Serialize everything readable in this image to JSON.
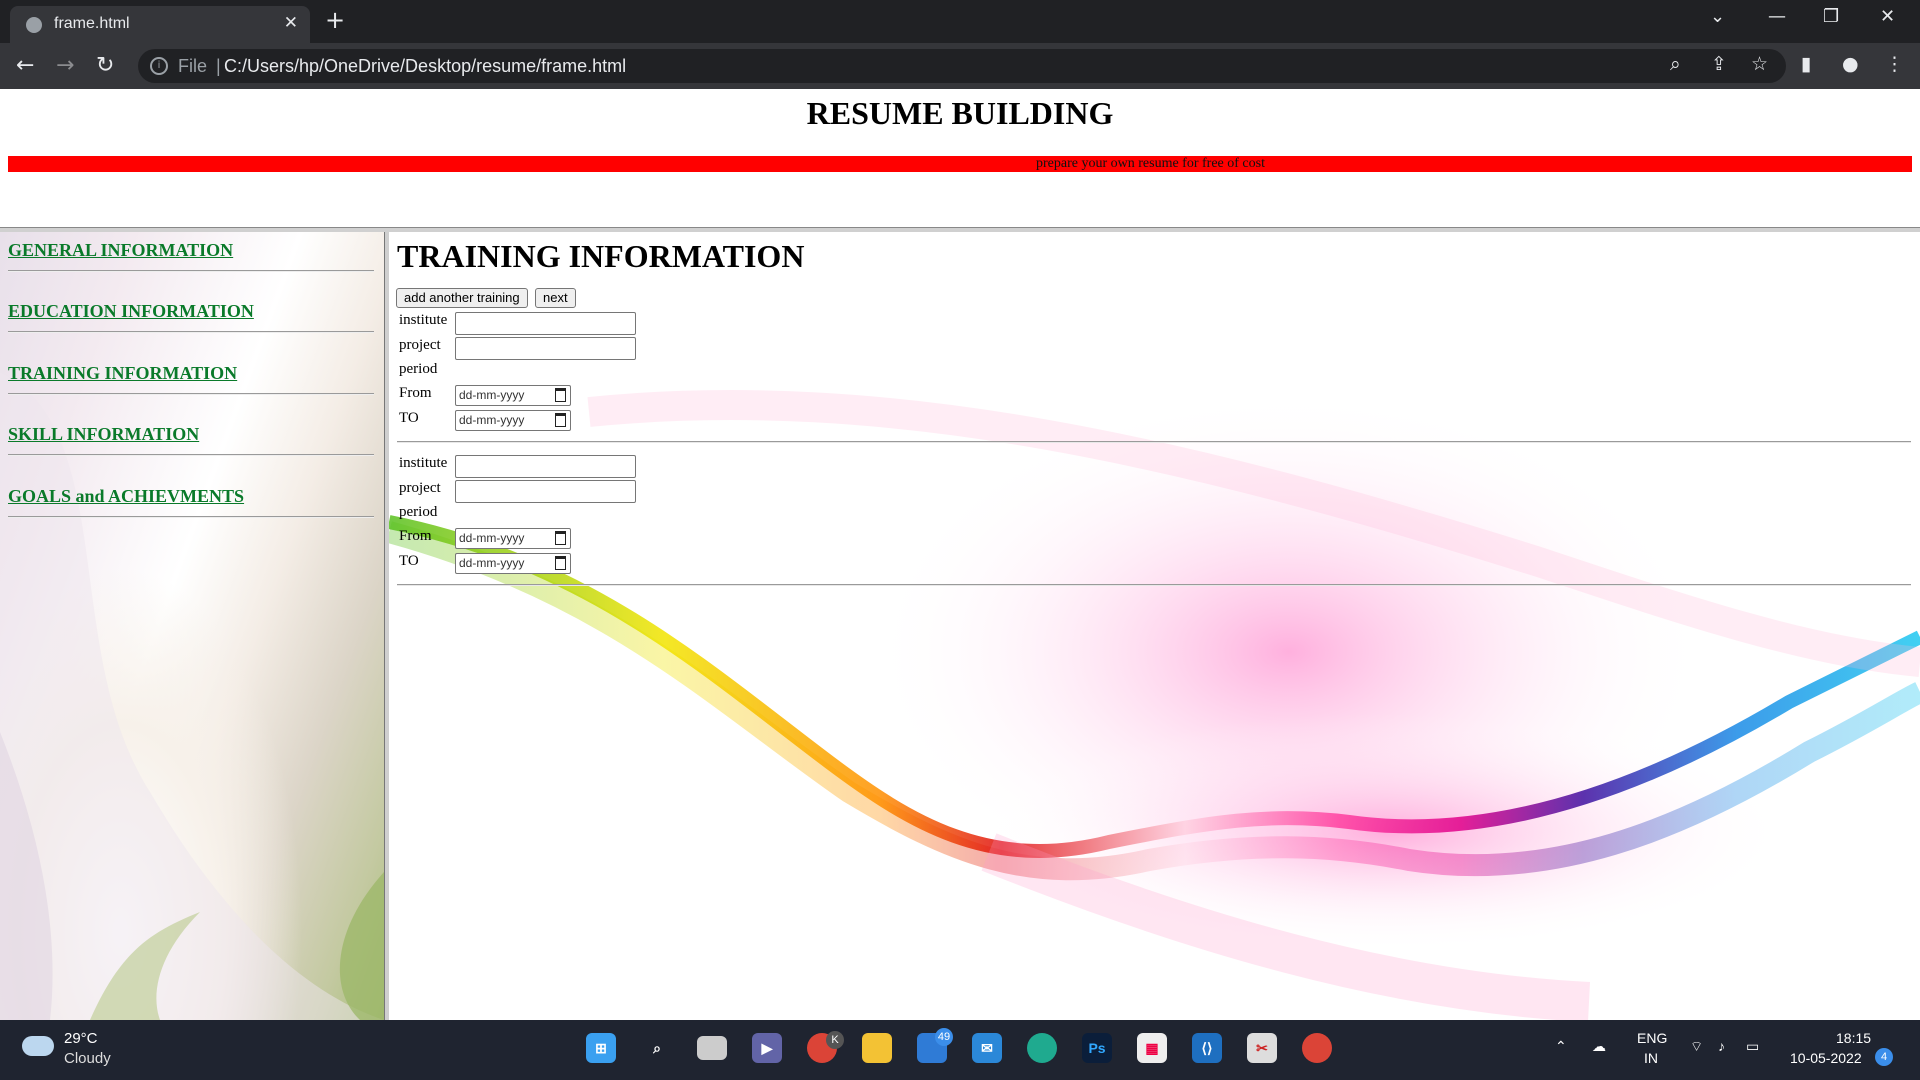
{
  "browser": {
    "tab_title": "frame.html",
    "new_tab": "+",
    "close_tab": "✕",
    "file_label": "File",
    "address": "C:/Users/hp/OneDrive/Desktop/resume/frame.html"
  },
  "header": {
    "title": "RESUME BUILDING",
    "marquee_text": "prepare your own resume for free of cost",
    "marquee_color": "#ff0000"
  },
  "sidebar": {
    "link_color": "#0a7a2a",
    "items": [
      {
        "label": "GENERAL INFORMATION"
      },
      {
        "label": "EDUCATION INFORMATION"
      },
      {
        "label": "TRAINING INFORMATION"
      },
      {
        "label": "SKILL INFORMATION"
      },
      {
        "label": "GOALS and ACHIEVMENTS"
      }
    ]
  },
  "main": {
    "title": "TRAINING INFORMATION",
    "add_button": "add another training",
    "next_button": "next",
    "labels": {
      "institute": "institute",
      "project": "project",
      "period": "period",
      "from": "From",
      "to": "TO"
    },
    "date_placeholder": "dd-mm-yyyy",
    "entries": [
      {
        "institute": "",
        "project": "",
        "from": "",
        "to": ""
      },
      {
        "institute": "",
        "project": "",
        "from": "",
        "to": ""
      }
    ]
  },
  "taskbar": {
    "temperature": "29°C",
    "weather": "Cloudy",
    "chrome_badge": "K",
    "mail_badge": "49",
    "language": "ENG",
    "region": "IN",
    "time": "18:15",
    "date": "10-05-2022",
    "notification_count": "4"
  }
}
